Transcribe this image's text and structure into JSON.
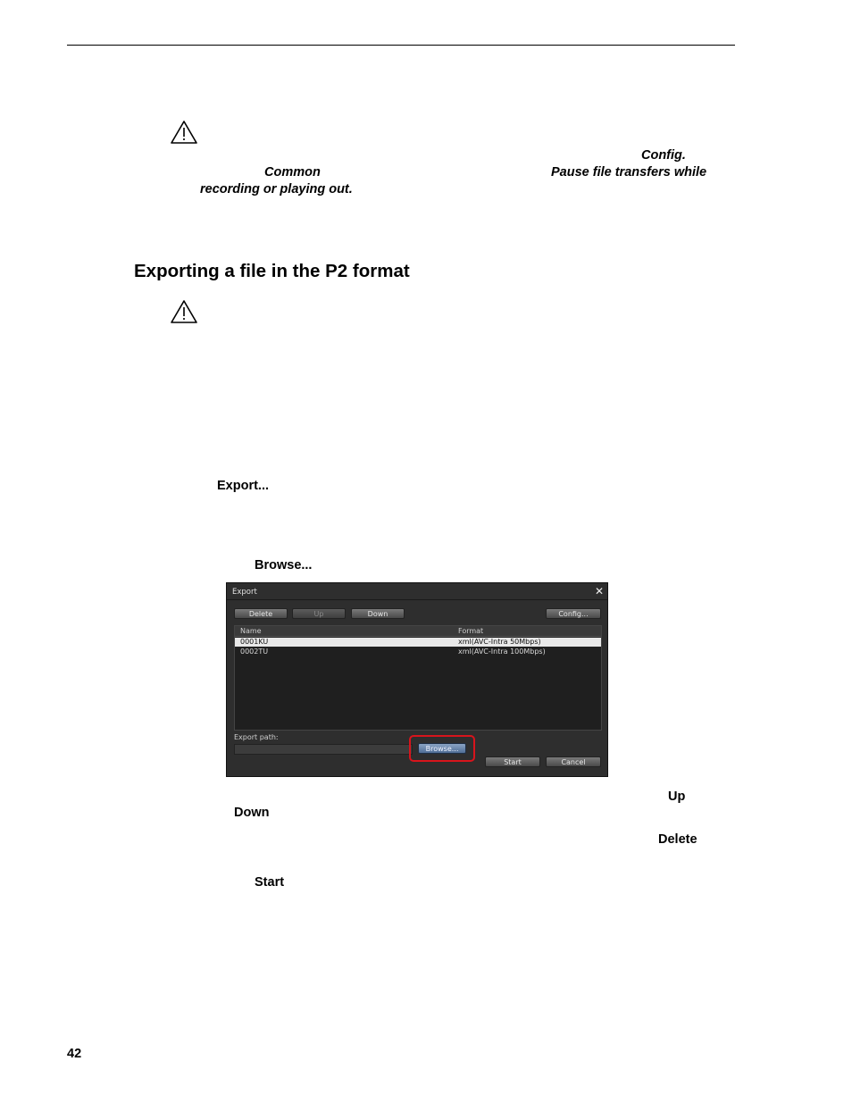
{
  "page": {
    "number": "42",
    "caution1": {
      "line1": "Config.",
      "line2a": "Common",
      "line2b": "Pause file transfers while",
      "line3": "recording or playing out."
    },
    "heading": "Exporting a file in the P2 format",
    "step_export": "Export...",
    "step_browse": "Browse...",
    "after": {
      "up": "Up",
      "down": "Down",
      "delete": "Delete",
      "start": "Start"
    }
  },
  "dialog": {
    "title": "Export",
    "close_glyph": "✕",
    "buttons": {
      "delete": "Delete",
      "up": "Up",
      "down": "Down",
      "config": "Config...",
      "browse": "Browse...",
      "start": "Start",
      "cancel": "Cancel"
    },
    "columns": [
      "Name",
      "Format"
    ],
    "rows": [
      {
        "name": "0001KU",
        "format": "xml(AVC-Intra 50Mbps)"
      },
      {
        "name": "0002TU",
        "format": "xml(AVC-Intra 100Mbps)"
      }
    ],
    "export_path_label": "Export path:",
    "export_path_value": ""
  },
  "icons": {
    "caution": "warning-triangle-icon",
    "close": "close-icon"
  },
  "colors": {
    "highlight": "#d8141c",
    "dialog_bg": "#2e2e2e"
  }
}
